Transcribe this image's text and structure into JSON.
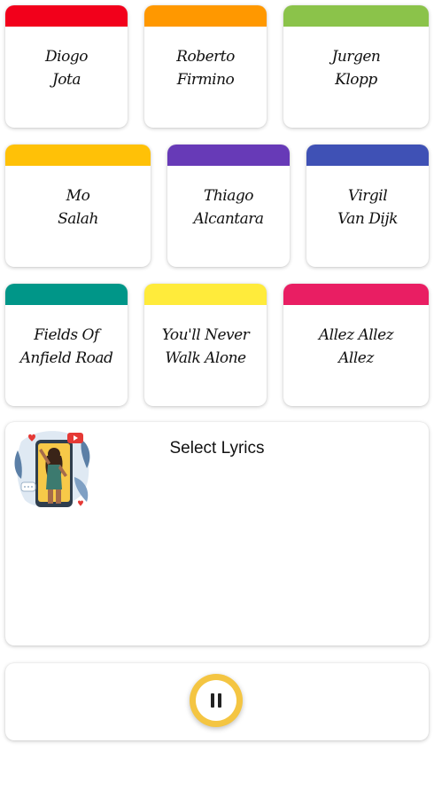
{
  "cards": [
    {
      "label": "Diogo\nJota",
      "color": "#f2001b"
    },
    {
      "label": "Roberto\nFirmino",
      "color": "#ff9800"
    },
    {
      "label": "Jurgen\nKlopp",
      "color": "#8bc34a"
    },
    {
      "label": "Mo\nSalah",
      "color": "#ffc107"
    },
    {
      "label": "Thiago\nAlcantara",
      "color": "#673ab7"
    },
    {
      "label": "Virgil\nVan Dijk",
      "color": "#3f51b5"
    },
    {
      "label": "Fields Of\nAnfield Road",
      "color": "#009688"
    },
    {
      "label": "You'll Never\nWalk Alone",
      "color": "#ffeb3b"
    },
    {
      "label": "Allez Allez\nAllez",
      "color": "#e91e63"
    }
  ],
  "lyrics": {
    "title": "Select Lyrics",
    "art_icon": "singer-illustration-icon"
  },
  "player": {
    "icon": "pause-icon",
    "accent_color": "#f4c542"
  }
}
